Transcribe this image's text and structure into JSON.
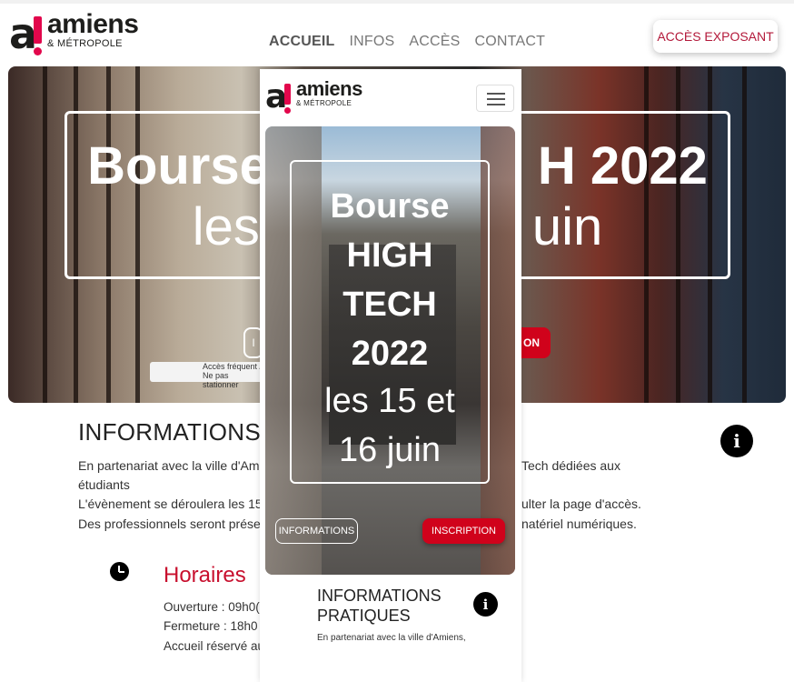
{
  "desktop": {
    "logo": {
      "word": "amiens",
      "sub": "& MÉTROPOLE"
    },
    "nav": [
      "ACCUEIL",
      "INFOS",
      "ACCÈS",
      "CONTACT"
    ],
    "cta": "ACCÈS EXPOSANT",
    "hero": {
      "title": "Bourse HIGH TECH 2022",
      "title_left": "Bourse",
      "title_right": "H 2022",
      "subtitle_left": "les",
      "subtitle_right": "uin",
      "btn_left_fragment": "I",
      "btn_right_fragment": "ON",
      "sign_text": "Accès fréquent / Ne pas stationner"
    },
    "informations": {
      "title": "INFORMATIONS",
      "lines": [
        [
          "En partenariat avec la ville d'Ami",
          "Tech dédiées aux"
        ],
        [
          "étudiants",
          ""
        ],
        [
          "L'évènement se déroulera les 15 -",
          "ulter la page d'accès."
        ],
        [
          "Des professionnels seront prése",
          "natériel numériques."
        ]
      ]
    },
    "horaires": {
      "title": "Horaires",
      "lines": [
        "Ouverture : 09h0(",
        "Fermeture : 18h0",
        "Accueil réservé aux étudiants, entrée libre."
      ]
    }
  },
  "mobile": {
    "logo": {
      "word": "amiens",
      "sub": "& MÉTROPOLE"
    },
    "hero": {
      "title_lines": [
        "Bourse",
        "HIGH",
        "TECH",
        "2022"
      ],
      "subtitle_lines": [
        "les 15 et",
        "16 juin"
      ]
    },
    "buttons": {
      "informations": "INFORMATIONS",
      "inscription": "INSCRIPTION"
    },
    "info_title": "INFORMATIONS PRATIQUES",
    "info_text": "En partenariat avec la ville d'Amiens,"
  },
  "colors": {
    "accent_red": "#d0021b",
    "heading_red": "#c8102e",
    "logo_pink": "#e2074c"
  }
}
